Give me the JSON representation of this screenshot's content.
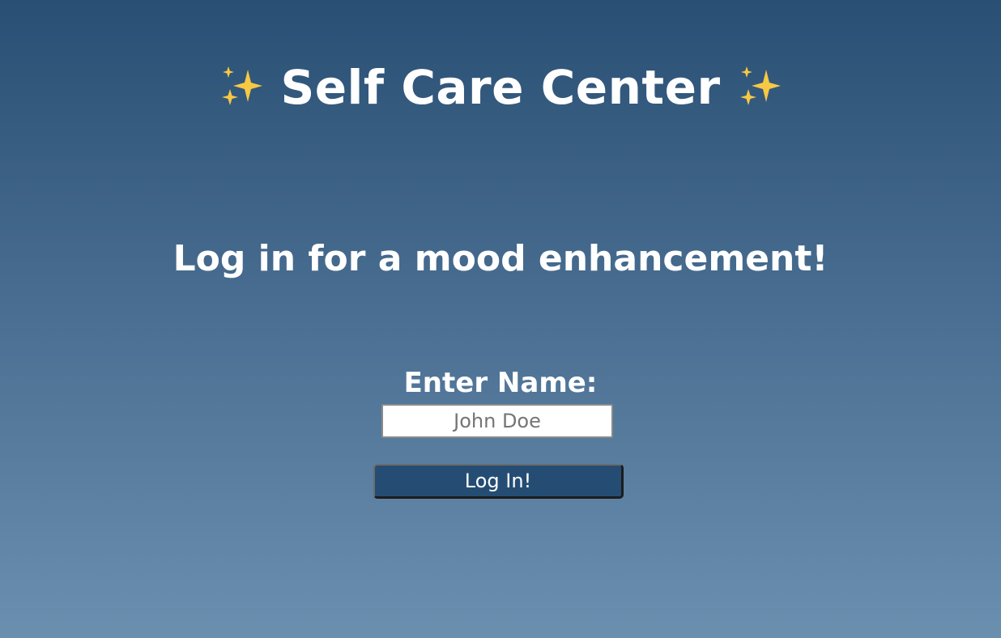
{
  "header": {
    "title": "Self Care Center",
    "left_icon": "sparkles-icon",
    "right_icon": "sparkles-icon",
    "sparkle_color": "#f7c843"
  },
  "main": {
    "tagline": "Log in for a mood enhancement!",
    "name_label": "Enter Name:",
    "name_input": {
      "value": "",
      "placeholder": "John Doe"
    },
    "login_button_label": "Log In!"
  },
  "colors": {
    "background_top": "#294f74",
    "background_bottom": "#6b8faf",
    "button_background": "#254d73",
    "text": "#ffffff"
  }
}
